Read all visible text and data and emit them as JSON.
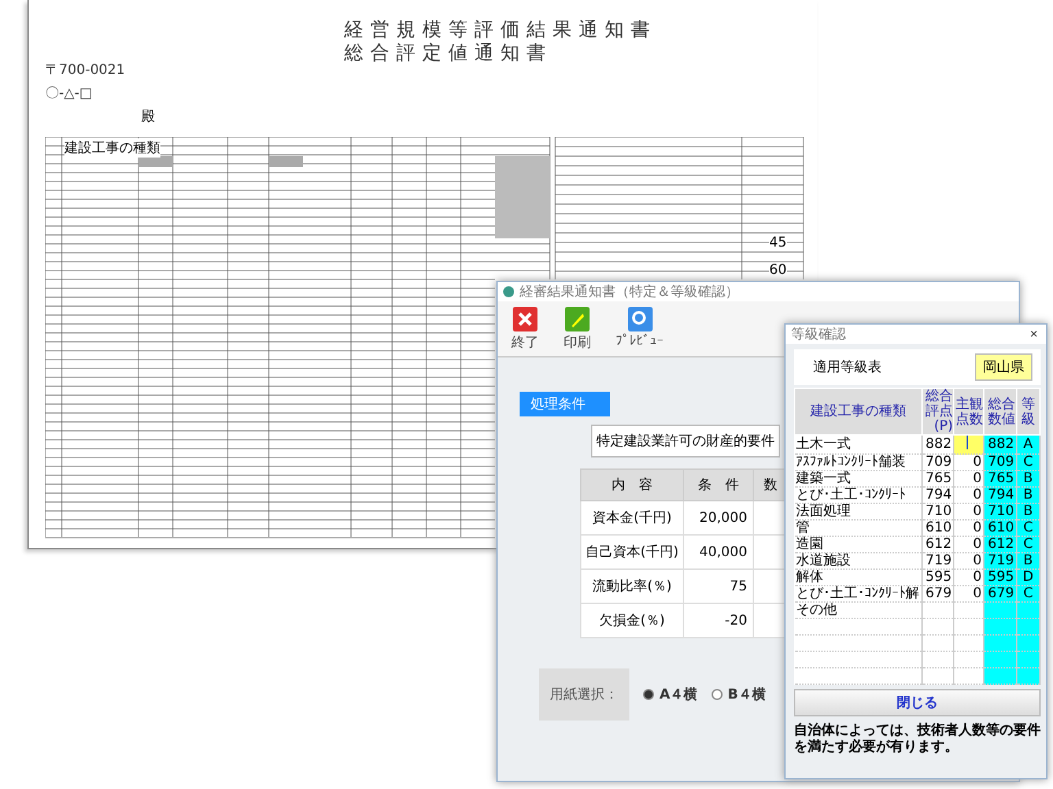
{
  "document": {
    "title_lines": [
      "経営規模等評価結果通知書",
      "総合評定値通知書"
    ],
    "postal_code": "〒700-0021",
    "address": "〇-△-□",
    "honorific": "殿",
    "table_header": "建設工事の種類",
    "right_values": [
      "45",
      "60"
    ]
  },
  "main_window": {
    "title": "経審結果通知書（特定＆等級確認）",
    "toolbar": [
      {
        "label": "終了",
        "kind": "exit"
      },
      {
        "label": "印刷",
        "kind": "print"
      },
      {
        "label": "ﾌﾟﾚﾋﾞｭｰ",
        "kind": "preview"
      }
    ],
    "section_label": "処理条件",
    "requirement_title": "特定建設業許可の財産的要件",
    "columns": [
      "内　容",
      "条　件",
      "数"
    ],
    "rows": [
      {
        "item": "資本金(千円)",
        "condition": "20,000"
      },
      {
        "item": "自己資本(千円)",
        "condition": "40,000"
      },
      {
        "item": "流動比率(％)",
        "condition": "75"
      },
      {
        "item": "欠損金(％)",
        "condition": "-20"
      }
    ],
    "paper": {
      "label": "用紙選択：",
      "options": [
        {
          "label": "A４横",
          "selected": true
        },
        {
          "label": "B４横",
          "selected": false
        }
      ]
    }
  },
  "grade_window": {
    "title": "等級確認",
    "close_glyph": "×",
    "table_label": "適用等級表",
    "prefecture": "岡山県",
    "columns": [
      "建設工事の種類",
      "総合評点(P)",
      "主観点数",
      "総合数値",
      "等級"
    ],
    "rows": [
      {
        "type": "土木一式",
        "score": "882",
        "subjective": "",
        "total": "882",
        "grade": "A",
        "editing": true
      },
      {
        "type": "ｱｽﾌｧﾙﾄｺﾝｸﾘｰﾄ舗装",
        "score": "709",
        "subjective": "0",
        "total": "709",
        "grade": "C",
        "editing": false
      },
      {
        "type": "建築一式",
        "score": "765",
        "subjective": "0",
        "total": "765",
        "grade": "B",
        "editing": false
      },
      {
        "type": "とび･土工･ｺﾝｸﾘｰﾄ",
        "score": "794",
        "subjective": "0",
        "total": "794",
        "grade": "B",
        "editing": false
      },
      {
        "type": "法面処理",
        "score": "710",
        "subjective": "0",
        "total": "710",
        "grade": "B",
        "editing": false
      },
      {
        "type": "管",
        "score": "610",
        "subjective": "0",
        "total": "610",
        "grade": "C",
        "editing": false
      },
      {
        "type": "造園",
        "score": "612",
        "subjective": "0",
        "total": "612",
        "grade": "C",
        "editing": false
      },
      {
        "type": "水道施設",
        "score": "719",
        "subjective": "0",
        "total": "719",
        "grade": "B",
        "editing": false
      },
      {
        "type": "解体",
        "score": "595",
        "subjective": "0",
        "total": "595",
        "grade": "D",
        "editing": false
      },
      {
        "type": "とび･土工･ｺﾝｸﾘｰﾄ解",
        "score": "679",
        "subjective": "0",
        "total": "679",
        "grade": "C",
        "editing": false
      },
      {
        "type": "その他",
        "score": "",
        "subjective": "",
        "total": "",
        "grade": "",
        "editing": false
      }
    ],
    "close_button": "閉じる",
    "note": "自治体によっては、技術者人数等の要件を満たす必要が有ります。"
  }
}
